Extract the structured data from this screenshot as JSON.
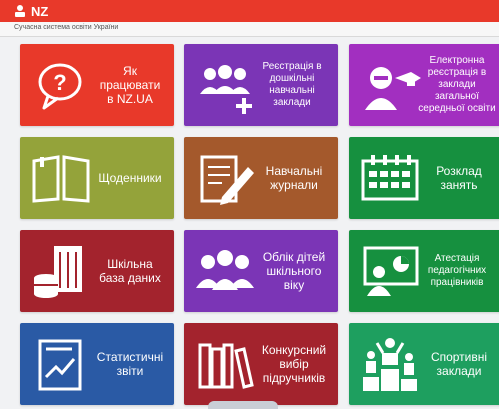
{
  "header": {
    "logo_text": "NZ",
    "tagline": "Сучасна система освіти України",
    "brand_color": "#e8392a"
  },
  "tiles": [
    {
      "label": "Як\nпрацювати\nв NZ.UA",
      "icon": "question-bubble-icon",
      "color": "#e8392a"
    },
    {
      "label": "Реєстрація в\nдошкільні\nнавчальні\nзаклади",
      "icon": "group-add-icon",
      "color": "#7b35b6"
    },
    {
      "label": "Електронна\nреєстрація в\nзаклади\nзагальної\nсередньої освіти",
      "icon": "graduate-icon",
      "color": "#a22fc0"
    },
    {
      "label": "Щоденники",
      "icon": "open-book-icon",
      "color": "#94a33a"
    },
    {
      "label": "Навчальні\nжурнали",
      "icon": "journal-pencil-icon",
      "color": "#a4592c"
    },
    {
      "label": "Розклад\nзанять",
      "icon": "calendar-icon",
      "color": "#16903f"
    },
    {
      "label": "Шкільна\nбаза даних",
      "icon": "database-icon",
      "color": "#a3232d"
    },
    {
      "label": "Облік дітей\nшкільного\nвіку",
      "icon": "children-group-icon",
      "color": "#7b35b6"
    },
    {
      "label": "Атестація\nпедагогічних\nпрацівників",
      "icon": "teacher-board-icon",
      "color": "#16903f"
    },
    {
      "label": "Статистичні\nзвіти",
      "icon": "report-chart-icon",
      "color": "#2a5aa5"
    },
    {
      "label": "Конкурсний\nвибір\nпідручників",
      "icon": "books-icon",
      "color": "#a3232d"
    },
    {
      "label": "Спортивні\nзаклади",
      "icon": "podium-icon",
      "color": "#1e9f5f"
    }
  ]
}
